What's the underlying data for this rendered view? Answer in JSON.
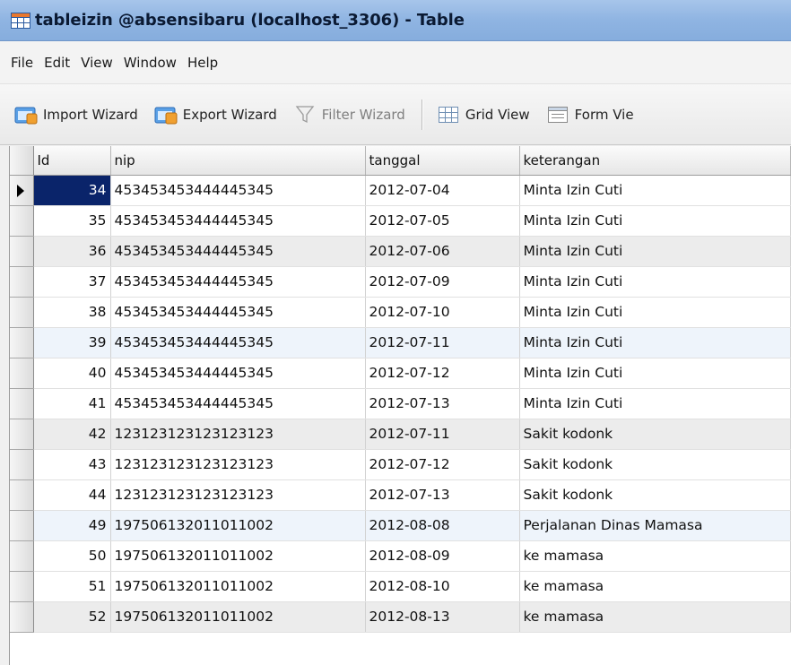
{
  "window": {
    "title": "tableizin @absensibaru (localhost_3306) - Table"
  },
  "menu": {
    "items": [
      "File",
      "Edit",
      "View",
      "Window",
      "Help"
    ]
  },
  "toolbar": {
    "import_label": "Import Wizard",
    "export_label": "Export Wizard",
    "filter_label": "Filter Wizard",
    "grid_view_label": "Grid View",
    "form_view_label": "Form Vie"
  },
  "grid": {
    "columns": [
      "Id",
      "nip",
      "tanggal",
      "keterangan"
    ],
    "active_row_id": "34",
    "rows": [
      {
        "id": "34",
        "nip": "453453453444445345",
        "tanggal": "2012-07-04",
        "keterangan": "Minta Izin Cuti"
      },
      {
        "id": "35",
        "nip": "453453453444445345",
        "tanggal": "2012-07-05",
        "keterangan": "Minta Izin Cuti"
      },
      {
        "id": "36",
        "nip": "453453453444445345",
        "tanggal": "2012-07-06",
        "keterangan": "Minta Izin Cuti"
      },
      {
        "id": "37",
        "nip": "453453453444445345",
        "tanggal": "2012-07-09",
        "keterangan": "Minta Izin Cuti"
      },
      {
        "id": "38",
        "nip": "453453453444445345",
        "tanggal": "2012-07-10",
        "keterangan": "Minta Izin Cuti"
      },
      {
        "id": "39",
        "nip": "453453453444445345",
        "tanggal": "2012-07-11",
        "keterangan": "Minta Izin Cuti"
      },
      {
        "id": "40",
        "nip": "453453453444445345",
        "tanggal": "2012-07-12",
        "keterangan": "Minta Izin Cuti"
      },
      {
        "id": "41",
        "nip": "453453453444445345",
        "tanggal": "2012-07-13",
        "keterangan": "Minta Izin Cuti"
      },
      {
        "id": "42",
        "nip": "123123123123123123",
        "tanggal": "2012-07-11",
        "keterangan": "Sakit kodonk"
      },
      {
        "id": "43",
        "nip": "123123123123123123",
        "tanggal": "2012-07-12",
        "keterangan": "Sakit kodonk"
      },
      {
        "id": "44",
        "nip": "123123123123123123",
        "tanggal": "2012-07-13",
        "keterangan": "Sakit kodonk"
      },
      {
        "id": "49",
        "nip": "197506132011011002",
        "tanggal": "2012-08-08",
        "keterangan": "Perjalanan Dinas Mamasa"
      },
      {
        "id": "50",
        "nip": "197506132011011002",
        "tanggal": "2012-08-09",
        "keterangan": "ke mamasa"
      },
      {
        "id": "51",
        "nip": "197506132011011002",
        "tanggal": "2012-08-10",
        "keterangan": "ke mamasa"
      },
      {
        "id": "52",
        "nip": "197506132011011002",
        "tanggal": "2012-08-13",
        "keterangan": "ke mamasa"
      }
    ]
  },
  "icons": {
    "table": "table-icon",
    "import": "import-wizard-icon",
    "export": "export-wizard-icon",
    "filter": "filter-icon",
    "grid": "grid-view-icon",
    "form": "form-view-icon"
  },
  "colors": {
    "titlebar": "#8fb4e2",
    "selection": "#0a246a",
    "alt_row": "#ececec",
    "highlight_row": "#eef4fb"
  }
}
